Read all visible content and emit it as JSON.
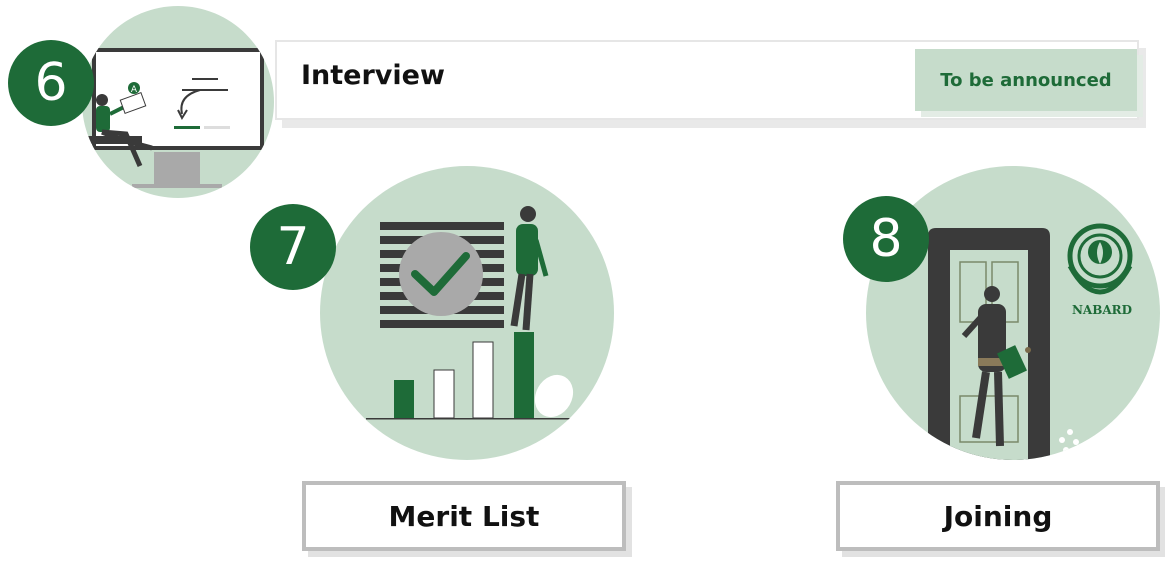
{
  "steps": [
    {
      "number": "6",
      "title": "Interview",
      "status": "To be announced"
    },
    {
      "number": "7",
      "title": "Merit List"
    },
    {
      "number": "8",
      "title": "Joining"
    }
  ],
  "illustration": {
    "interview_screen_letter": "A",
    "logo_text": "NABARD"
  },
  "colors": {
    "primary_green": "#1e6b38",
    "light_green": "#c6dccb",
    "dark_gray": "#3a3a3a",
    "border_gray": "#bdbdbd"
  }
}
